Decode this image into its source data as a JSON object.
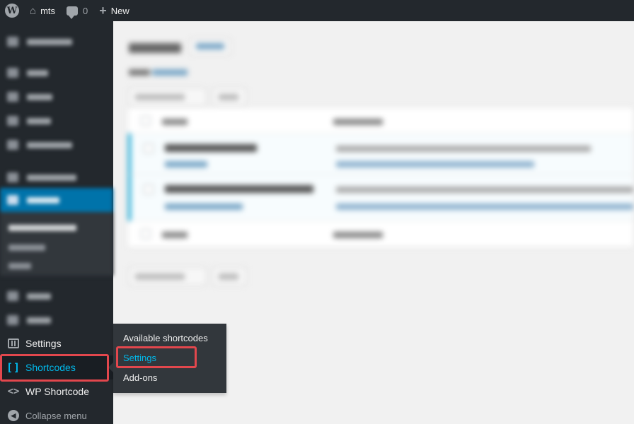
{
  "admin_bar": {
    "site_name": "mts",
    "comments_count": "0",
    "new_label": "New"
  },
  "sidebar": {
    "settings_label": "Settings",
    "shortcodes_label": "Shortcodes",
    "wp_shortcode_label": "WP Shortcode",
    "collapse_label": "Collapse menu"
  },
  "flyout": {
    "items": [
      "Available shortcodes",
      "Settings",
      "Add-ons"
    ]
  },
  "colors": {
    "admin_bg": "#23282d",
    "accent_blue": "#0073aa",
    "highlight": "#00b9eb",
    "annotation_red": "#e2474d"
  }
}
